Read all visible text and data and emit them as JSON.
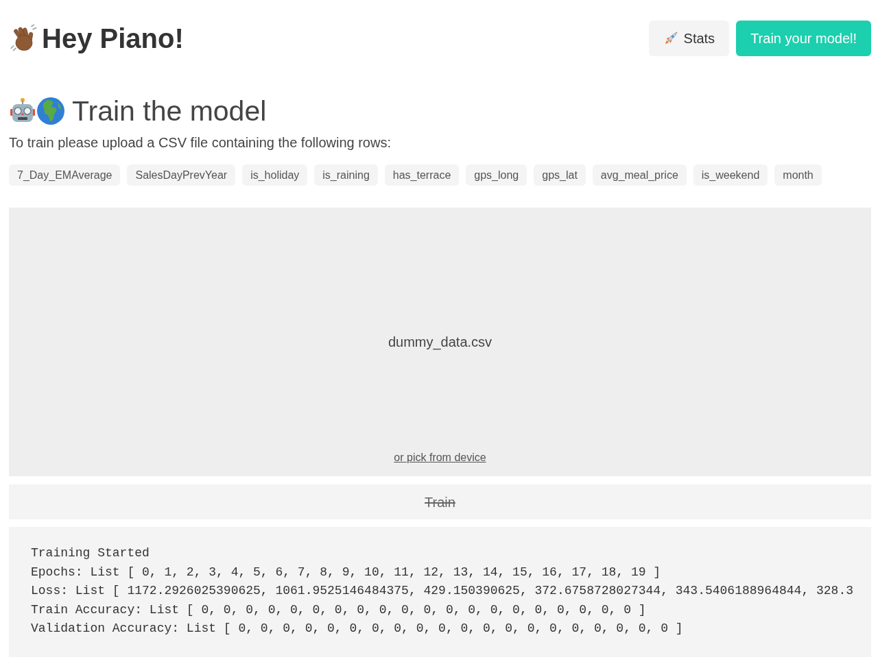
{
  "header": {
    "title": "Hey Piano!",
    "buttons": [
      {
        "label": "Stats",
        "kind": "secondary"
      },
      {
        "label": "Train your model!",
        "kind": "primary"
      }
    ]
  },
  "section": {
    "title": "Train the model",
    "instructions": "To train please upload a CSV file containing the following rows:",
    "columns": [
      "7_Day_EMAverage",
      "SalesDayPrevYear",
      "is_holiday",
      "is_raining",
      "has_terrace",
      "gps_long",
      "gps_lat",
      "avg_meal_price",
      "is_weekend",
      "month"
    ]
  },
  "upload": {
    "file_name": "dummy_data.csv",
    "pick_link": "or pick from device"
  },
  "train_button": {
    "label": "Train",
    "disabled": true
  },
  "log": {
    "lines": [
      "Training Started",
      "Epochs: List [ 0, 1, 2, 3, 4, 5, 6, 7, 8, 9, 10, 11, 12, 13, 14, 15, 16, 17, 18, 19 ]",
      "Loss: List [ 1172.2926025390625, 1061.9525146484375, 429.150390625, 372.6758728027344, 343.5406188964844, 328.3",
      "Train Accuracy: List [ 0, 0, 0, 0, 0, 0, 0, 0, 0, 0, 0, 0, 0, 0, 0, 0, 0, 0, 0, 0 ]",
      "Validation Accuracy: List [ 0, 0, 0, 0, 0, 0, 0, 0, 0, 0, 0, 0, 0, 0, 0, 0, 0, 0, 0, 0 ]"
    ]
  }
}
